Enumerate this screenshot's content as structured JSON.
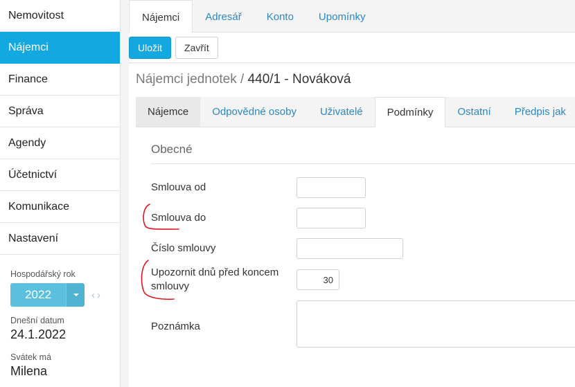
{
  "sidebar": {
    "items": [
      {
        "label": "Nemovitost"
      },
      {
        "label": "Nájemci"
      },
      {
        "label": "Finance"
      },
      {
        "label": "Správa"
      },
      {
        "label": "Agendy"
      },
      {
        "label": "Účetnictví"
      },
      {
        "label": "Komunikace"
      },
      {
        "label": "Nastavení"
      }
    ],
    "fiscal_year_label": "Hospodářský rok",
    "fiscal_year_value": "2022",
    "today_label": "Dnešní datum",
    "today_value": "24.1.2022",
    "nameday_label": "Svátek má",
    "nameday_value": "Milena"
  },
  "top_tabs": [
    {
      "label": "Nájemci"
    },
    {
      "label": "Adresář"
    },
    {
      "label": "Konto"
    },
    {
      "label": "Upomínky"
    }
  ],
  "toolbar": {
    "save_label": "Uložit",
    "close_label": "Zavřít"
  },
  "page": {
    "title_prefix": "Nájemci jednotek / ",
    "title_main": "440/1 - Nováková"
  },
  "inner_tabs": [
    {
      "label": "Nájemce"
    },
    {
      "label": "Odpovědné osoby"
    },
    {
      "label": "Uživatelé"
    },
    {
      "label": "Podmínky"
    },
    {
      "label": "Ostatní"
    },
    {
      "label": "Předpis jak"
    }
  ],
  "form": {
    "section_title": "Obecné",
    "contract_from_label": "Smlouva od",
    "contract_from_value": "",
    "contract_to_label": "Smlouva do",
    "contract_to_value": "",
    "contract_number_label": "Číslo smlouvy",
    "contract_number_value": "",
    "notify_days_label": "Upozornit dnů před koncem smlouvy",
    "notify_days_value": "30",
    "note_label": "Poznámka",
    "note_value": ""
  },
  "colors": {
    "accent": "#13a9e0",
    "year_button": "#5bc0de",
    "link": "#2b87c5",
    "annotation": "#e0141e"
  }
}
